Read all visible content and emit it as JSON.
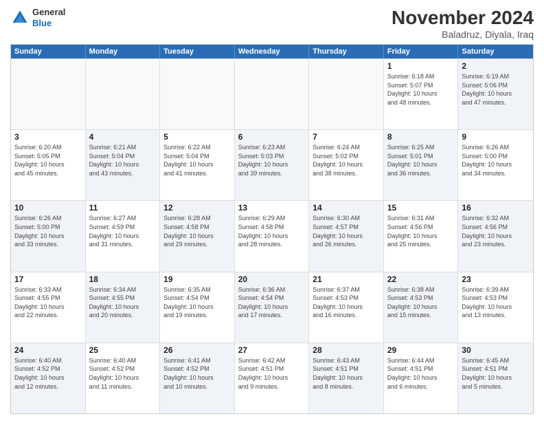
{
  "logo": {
    "general": "General",
    "blue": "Blue"
  },
  "title": "November 2024",
  "subtitle": "Baladruz, Diyala, Iraq",
  "header_days": [
    "Sunday",
    "Monday",
    "Tuesday",
    "Wednesday",
    "Thursday",
    "Friday",
    "Saturday"
  ],
  "weeks": [
    [
      {
        "day": "",
        "info": "",
        "shaded": false,
        "empty": true
      },
      {
        "day": "",
        "info": "",
        "shaded": false,
        "empty": true
      },
      {
        "day": "",
        "info": "",
        "shaded": false,
        "empty": true
      },
      {
        "day": "",
        "info": "",
        "shaded": false,
        "empty": true
      },
      {
        "day": "",
        "info": "",
        "shaded": false,
        "empty": true
      },
      {
        "day": "1",
        "info": "Sunrise: 6:18 AM\nSunset: 5:07 PM\nDaylight: 10 hours\nand 48 minutes.",
        "shaded": false,
        "empty": false
      },
      {
        "day": "2",
        "info": "Sunrise: 6:19 AM\nSunset: 5:06 PM\nDaylight: 10 hours\nand 47 minutes.",
        "shaded": true,
        "empty": false
      }
    ],
    [
      {
        "day": "3",
        "info": "Sunrise: 6:20 AM\nSunset: 5:05 PM\nDaylight: 10 hours\nand 45 minutes.",
        "shaded": false,
        "empty": false
      },
      {
        "day": "4",
        "info": "Sunrise: 6:21 AM\nSunset: 5:04 PM\nDaylight: 10 hours\nand 43 minutes.",
        "shaded": true,
        "empty": false
      },
      {
        "day": "5",
        "info": "Sunrise: 6:22 AM\nSunset: 5:04 PM\nDaylight: 10 hours\nand 41 minutes.",
        "shaded": false,
        "empty": false
      },
      {
        "day": "6",
        "info": "Sunrise: 6:23 AM\nSunset: 5:03 PM\nDaylight: 10 hours\nand 39 minutes.",
        "shaded": true,
        "empty": false
      },
      {
        "day": "7",
        "info": "Sunrise: 6:24 AM\nSunset: 5:02 PM\nDaylight: 10 hours\nand 38 minutes.",
        "shaded": false,
        "empty": false
      },
      {
        "day": "8",
        "info": "Sunrise: 6:25 AM\nSunset: 5:01 PM\nDaylight: 10 hours\nand 36 minutes.",
        "shaded": true,
        "empty": false
      },
      {
        "day": "9",
        "info": "Sunrise: 6:26 AM\nSunset: 5:00 PM\nDaylight: 10 hours\nand 34 minutes.",
        "shaded": false,
        "empty": false
      }
    ],
    [
      {
        "day": "10",
        "info": "Sunrise: 6:26 AM\nSunset: 5:00 PM\nDaylight: 10 hours\nand 33 minutes.",
        "shaded": true,
        "empty": false
      },
      {
        "day": "11",
        "info": "Sunrise: 6:27 AM\nSunset: 4:59 PM\nDaylight: 10 hours\nand 31 minutes.",
        "shaded": false,
        "empty": false
      },
      {
        "day": "12",
        "info": "Sunrise: 6:28 AM\nSunset: 4:58 PM\nDaylight: 10 hours\nand 29 minutes.",
        "shaded": true,
        "empty": false
      },
      {
        "day": "13",
        "info": "Sunrise: 6:29 AM\nSunset: 4:58 PM\nDaylight: 10 hours\nand 28 minutes.",
        "shaded": false,
        "empty": false
      },
      {
        "day": "14",
        "info": "Sunrise: 6:30 AM\nSunset: 4:57 PM\nDaylight: 10 hours\nand 26 minutes.",
        "shaded": true,
        "empty": false
      },
      {
        "day": "15",
        "info": "Sunrise: 6:31 AM\nSunset: 4:56 PM\nDaylight: 10 hours\nand 25 minutes.",
        "shaded": false,
        "empty": false
      },
      {
        "day": "16",
        "info": "Sunrise: 6:32 AM\nSunset: 4:56 PM\nDaylight: 10 hours\nand 23 minutes.",
        "shaded": true,
        "empty": false
      }
    ],
    [
      {
        "day": "17",
        "info": "Sunrise: 6:33 AM\nSunset: 4:55 PM\nDaylight: 10 hours\nand 22 minutes.",
        "shaded": false,
        "empty": false
      },
      {
        "day": "18",
        "info": "Sunrise: 6:34 AM\nSunset: 4:55 PM\nDaylight: 10 hours\nand 20 minutes.",
        "shaded": true,
        "empty": false
      },
      {
        "day": "19",
        "info": "Sunrise: 6:35 AM\nSunset: 4:54 PM\nDaylight: 10 hours\nand 19 minutes.",
        "shaded": false,
        "empty": false
      },
      {
        "day": "20",
        "info": "Sunrise: 6:36 AM\nSunset: 4:54 PM\nDaylight: 10 hours\nand 17 minutes.",
        "shaded": true,
        "empty": false
      },
      {
        "day": "21",
        "info": "Sunrise: 6:37 AM\nSunset: 4:53 PM\nDaylight: 10 hours\nand 16 minutes.",
        "shaded": false,
        "empty": false
      },
      {
        "day": "22",
        "info": "Sunrise: 6:38 AM\nSunset: 4:53 PM\nDaylight: 10 hours\nand 15 minutes.",
        "shaded": true,
        "empty": false
      },
      {
        "day": "23",
        "info": "Sunrise: 6:39 AM\nSunset: 4:53 PM\nDaylight: 10 hours\nand 13 minutes.",
        "shaded": false,
        "empty": false
      }
    ],
    [
      {
        "day": "24",
        "info": "Sunrise: 6:40 AM\nSunset: 4:52 PM\nDaylight: 10 hours\nand 12 minutes.",
        "shaded": true,
        "empty": false
      },
      {
        "day": "25",
        "info": "Sunrise: 6:40 AM\nSunset: 4:52 PM\nDaylight: 10 hours\nand 11 minutes.",
        "shaded": false,
        "empty": false
      },
      {
        "day": "26",
        "info": "Sunrise: 6:41 AM\nSunset: 4:52 PM\nDaylight: 10 hours\nand 10 minutes.",
        "shaded": true,
        "empty": false
      },
      {
        "day": "27",
        "info": "Sunrise: 6:42 AM\nSunset: 4:51 PM\nDaylight: 10 hours\nand 9 minutes.",
        "shaded": false,
        "empty": false
      },
      {
        "day": "28",
        "info": "Sunrise: 6:43 AM\nSunset: 4:51 PM\nDaylight: 10 hours\nand 8 minutes.",
        "shaded": true,
        "empty": false
      },
      {
        "day": "29",
        "info": "Sunrise: 6:44 AM\nSunset: 4:51 PM\nDaylight: 10 hours\nand 6 minutes.",
        "shaded": false,
        "empty": false
      },
      {
        "day": "30",
        "info": "Sunrise: 6:45 AM\nSunset: 4:51 PM\nDaylight: 10 hours\nand 5 minutes.",
        "shaded": true,
        "empty": false
      }
    ]
  ]
}
